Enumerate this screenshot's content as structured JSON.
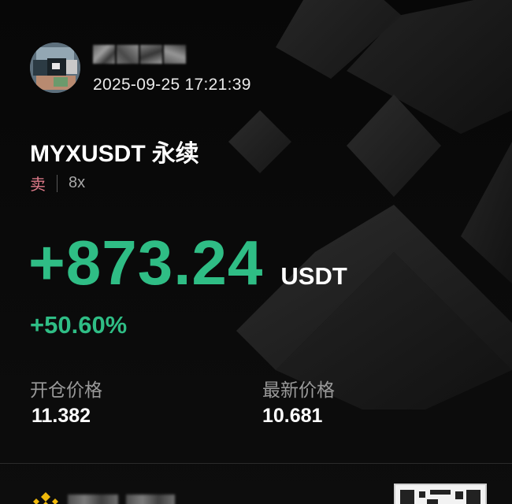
{
  "header": {
    "username": "",
    "timestamp": "2025-09-25 17:21:39",
    "avatar_icon": "avatar-icon"
  },
  "position": {
    "symbol": "MYXUSDT",
    "contract_type": "永续",
    "side": "卖",
    "leverage": "8x"
  },
  "pnl": {
    "value": "+873.24",
    "unit": "USDT",
    "percent": "+50.60%"
  },
  "prices": {
    "entry_label": "开仓价格",
    "entry_value": "11.382",
    "last_label": "最新价格",
    "last_value": "10.681"
  },
  "footer": {
    "logo_icon": "brand-logo-icon",
    "qr_icon": "qr-code-icon"
  },
  "colors": {
    "profit_green": "#2fbd85",
    "sell_red": "#e07b8a",
    "background": "#0b0b0b",
    "muted_text": "#9a9a9a"
  }
}
